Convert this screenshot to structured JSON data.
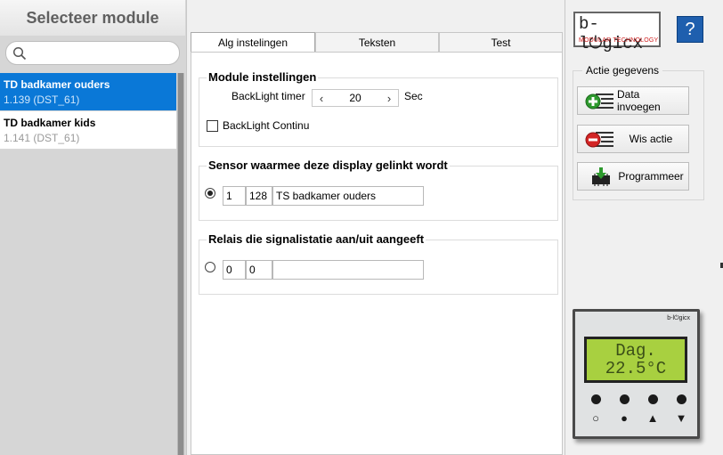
{
  "sidebar": {
    "title": "Selecteer module",
    "search_placeholder": "",
    "modules": [
      {
        "name": "TD badkamer ouders",
        "sub": "1.139 (DST_61)",
        "selected": true
      },
      {
        "name": "TD badkamer kids",
        "sub": "1.141 (DST_61)",
        "selected": false
      }
    ]
  },
  "tabs": [
    "Alg instelingen",
    "Teksten",
    "Test"
  ],
  "module_settings": {
    "title": "Module instellingen",
    "backlight_label": "BackLight timer",
    "backlight_value": "20",
    "backlight_unit": "Sec",
    "backlight_continu_label": "BackLight Continu",
    "backlight_continu_checked": false
  },
  "sensor": {
    "title": "Sensor waarmee deze display gelinkt wordt",
    "selected": true,
    "field1": "1",
    "field2": "128",
    "name": "TS badkamer ouders"
  },
  "relais": {
    "title": "Relais die signalistatie aan/uit aangeeft",
    "selected": false,
    "field1": "0",
    "field2": "0",
    "name": ""
  },
  "logo": {
    "text": "b-l⏻gicx",
    "subtitle": "MODULAR TECHNOLOGY"
  },
  "help_label": "?",
  "actie": {
    "title": "Actie gegevens",
    "buttons": [
      "Data invoegen",
      "Wis actie",
      "Programmeer"
    ]
  },
  "device": {
    "brand": "b-l⏻gicx",
    "line1": "Dag.",
    "line2": "22.5°C",
    "lcd_color": "#a8d040"
  },
  "colors": {
    "accent": "#0a78d7",
    "help": "#1f5fae"
  }
}
